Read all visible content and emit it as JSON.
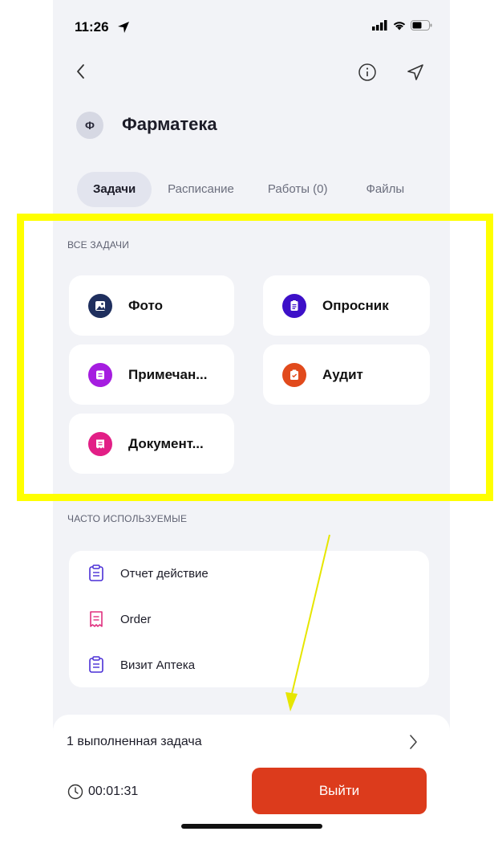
{
  "status_bar": {
    "time": "11:26"
  },
  "header": {
    "avatar_letter": "Ф",
    "title": "Фарматека"
  },
  "tabs": [
    {
      "label": "Задачи",
      "active": true
    },
    {
      "label": "Расписание"
    },
    {
      "label": "Работы (0)"
    },
    {
      "label": "Файлы"
    }
  ],
  "all_tasks": {
    "label": "ВСЕ ЗАДАЧИ",
    "items": [
      {
        "label": "Фото",
        "icon": "photo-icon",
        "color": "#1f2f5e"
      },
      {
        "label": "Опросник",
        "icon": "survey-icon",
        "color": "#3d10c8"
      },
      {
        "label": "Примечан...",
        "icon": "note-icon",
        "color": "#a51de0"
      },
      {
        "label": "Аудит",
        "icon": "audit-icon",
        "color": "#e14a1c"
      },
      {
        "label": "Документ...",
        "icon": "document-icon",
        "color": "#e21f86"
      }
    ]
  },
  "frequent": {
    "label": "ЧАСТО ИСПОЛЬЗУЕМЫЕ",
    "items": [
      {
        "label": "Отчет действие",
        "icon": "clipboard-icon",
        "color": "#4a2fd6"
      },
      {
        "label": "Order",
        "icon": "receipt-icon",
        "color": "#e0307f"
      },
      {
        "label": "Визит Аптека",
        "icon": "clipboard-icon",
        "color": "#4a2fd6"
      }
    ]
  },
  "bottom": {
    "completed": "1 выполненная задача",
    "timer": "00:01:31",
    "exit_label": "Выйти",
    "exit_color": "#dc3b1c"
  },
  "annotation": {
    "highlight_color": "#ffff00",
    "arrow_color": "#e6e600"
  }
}
